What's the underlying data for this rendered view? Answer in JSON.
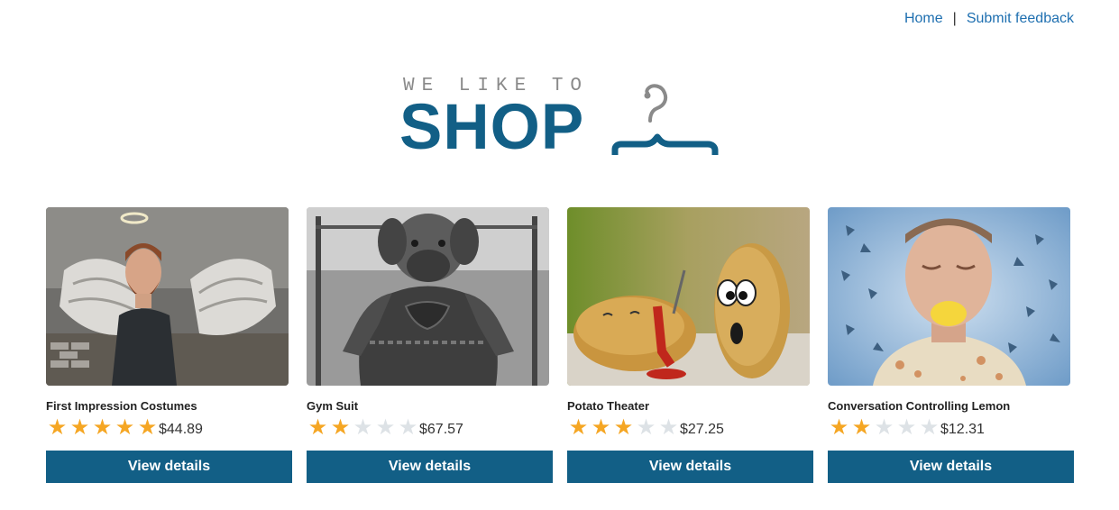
{
  "nav": {
    "home": "Home",
    "separator": "|",
    "feedback": "Submit feedback"
  },
  "logo": {
    "tagline": "WE LIKE TO",
    "word": "SHOP"
  },
  "colors": {
    "brand": "#125f86",
    "link": "#1e6fb0",
    "star": "#f5a623",
    "star_off": "#dde2e6"
  },
  "products": [
    {
      "title": "First Impression Costumes",
      "rating": 5,
      "price": "$44.89",
      "button": "View details"
    },
    {
      "title": "Gym Suit",
      "rating": 2,
      "price": "$67.57",
      "button": "View details"
    },
    {
      "title": "Potato Theater",
      "rating": 3,
      "price": "$27.25",
      "button": "View details"
    },
    {
      "title": "Conversation Controlling Lemon",
      "rating": 2,
      "price": "$12.31",
      "button": "View details"
    }
  ]
}
